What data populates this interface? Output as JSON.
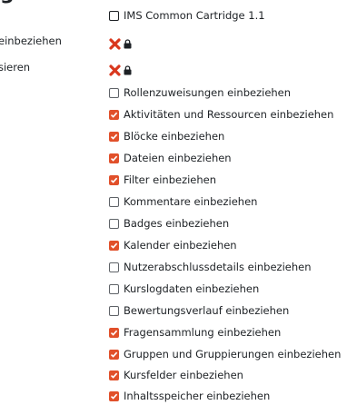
{
  "heading": "g",
  "cartridge": {
    "label": "IMS Common Cartridge 1.1",
    "checked": false
  },
  "left_labels": [
    "einbeziehen",
    "sieren"
  ],
  "options": [
    {
      "label": "Rollenzuweisungen einbeziehen",
      "checked": false
    },
    {
      "label": "Aktivitäten und Ressourcen einbeziehen",
      "checked": true
    },
    {
      "label": "Blöcke einbeziehen",
      "checked": true
    },
    {
      "label": "Dateien einbeziehen",
      "checked": true
    },
    {
      "label": "Filter einbeziehen",
      "checked": true
    },
    {
      "label": "Kommentare einbeziehen",
      "checked": false
    },
    {
      "label": "Badges einbeziehen",
      "checked": false
    },
    {
      "label": "Kalender einbeziehen",
      "checked": true
    },
    {
      "label": "Nutzerabschlussdetails einbeziehen",
      "checked": false
    },
    {
      "label": "Kurslogdaten einbeziehen",
      "checked": false
    },
    {
      "label": "Bewertungsverlauf einbeziehen",
      "checked": false
    },
    {
      "label": "Fragensammlung einbeziehen",
      "checked": true
    },
    {
      "label": "Gruppen und Gruppierungen einbeziehen",
      "checked": true
    },
    {
      "label": "Kursfelder einbeziehen",
      "checked": true
    },
    {
      "label": "Inhaltsspeicher einbeziehen",
      "checked": true
    }
  ],
  "colors": {
    "checked": "#e1502a",
    "cross": "#d9381e",
    "text": "#1d2125"
  },
  "icons": {
    "disabled": "cross-icon",
    "locked": "lock-icon"
  }
}
